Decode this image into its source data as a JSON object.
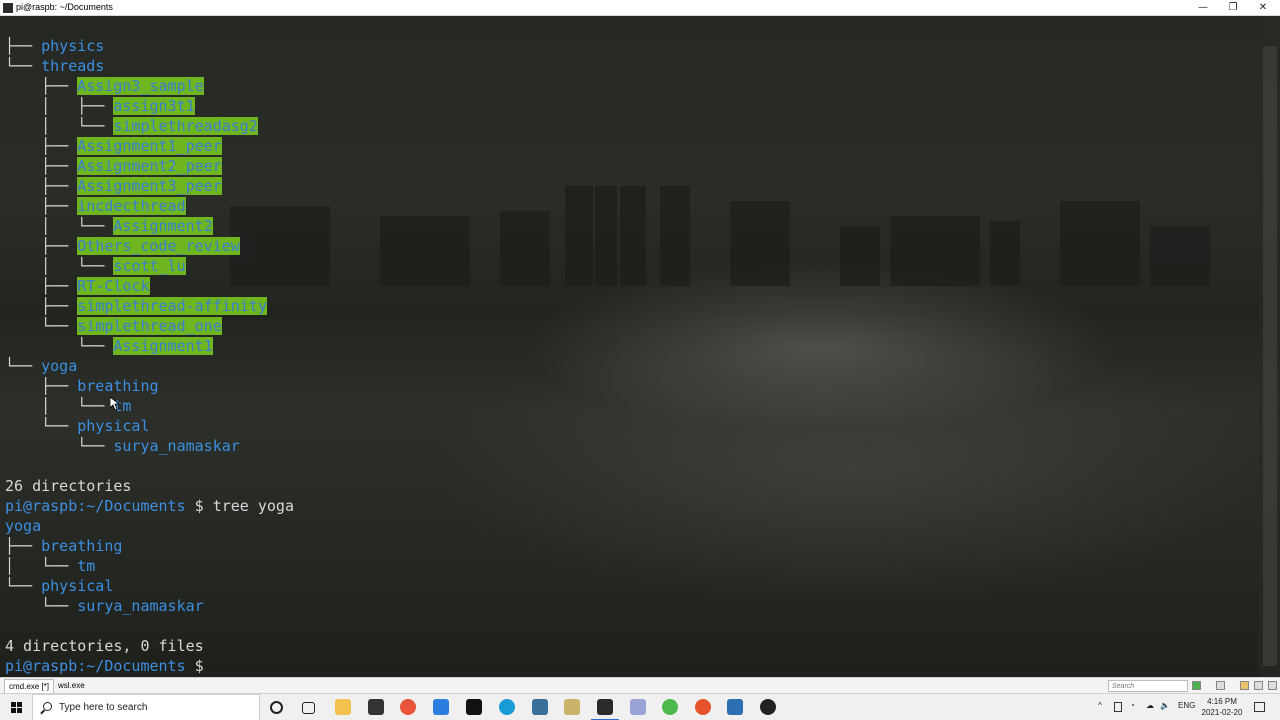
{
  "window": {
    "title": "pi@raspb: ~/Documents",
    "minimize_glyph": "—",
    "maximize_glyph": "❐",
    "close_glyph": "✕"
  },
  "terminal_lines": [
    {
      "tree": "├── ",
      "indent": "",
      "name": "physics",
      "style": "dir"
    },
    {
      "tree": "└── ",
      "indent": "",
      "name": "threads",
      "style": "dir"
    },
    {
      "tree": "    ├── ",
      "indent": "",
      "name": "Assign3_sample",
      "style": "hl"
    },
    {
      "tree": "    │   ├── ",
      "indent": "",
      "name": "assign3t1",
      "style": "hl"
    },
    {
      "tree": "    │   └── ",
      "indent": "",
      "name": "simplethreadasg2",
      "style": "hl"
    },
    {
      "tree": "    ├── ",
      "indent": "",
      "name": "Assignment1_peer",
      "style": "hl"
    },
    {
      "tree": "    ├── ",
      "indent": "",
      "name": "Assignment2_peer",
      "style": "hl"
    },
    {
      "tree": "    ├── ",
      "indent": "",
      "name": "Assignment3_peer",
      "style": "hl"
    },
    {
      "tree": "    ├── ",
      "indent": "",
      "name": "incdecthread",
      "style": "hl"
    },
    {
      "tree": "    │   └── ",
      "indent": "",
      "name": "Assignment2",
      "style": "hl"
    },
    {
      "tree": "    ├── ",
      "indent": "",
      "name": "Others_code_review",
      "style": "hl"
    },
    {
      "tree": "    │   └── ",
      "indent": "",
      "name": "scott_lu",
      "style": "hl"
    },
    {
      "tree": "    ├── ",
      "indent": "",
      "name": "RT-Clock",
      "style": "hl"
    },
    {
      "tree": "    ├── ",
      "indent": "",
      "name": "simplethread-affinity",
      "style": "hl"
    },
    {
      "tree": "    └── ",
      "indent": "",
      "name": "simplethread_one",
      "style": "hl"
    },
    {
      "tree": "        └── ",
      "indent": "",
      "name": "Assignment1",
      "style": "hl"
    },
    {
      "tree": "└── ",
      "indent": "",
      "name": "yoga",
      "style": "dir"
    },
    {
      "tree": "    ├── ",
      "indent": "",
      "name": "breathing",
      "style": "dir"
    },
    {
      "tree": "    │   └── ",
      "indent": "",
      "name": "tm",
      "style": "dir"
    },
    {
      "tree": "    └── ",
      "indent": "",
      "name": "physical",
      "style": "dir"
    },
    {
      "tree": "        └── ",
      "indent": "",
      "name": "surya_namaskar",
      "style": "dir"
    },
    {
      "tree": "",
      "indent": "",
      "name": "",
      "style": "txt"
    },
    {
      "tree": "",
      "indent": "",
      "name": "26 directories",
      "style": "txt"
    },
    {
      "tree": "",
      "indent": "",
      "name": "",
      "style": "prompt",
      "user": "pi@raspb",
      "path": ":~/Documents",
      "cmd": " $ tree yoga"
    },
    {
      "tree": "",
      "indent": "",
      "name": "yoga",
      "style": "dir"
    },
    {
      "tree": "├── ",
      "indent": "",
      "name": "breathing",
      "style": "dir"
    },
    {
      "tree": "│   └── ",
      "indent": "",
      "name": "tm",
      "style": "dir"
    },
    {
      "tree": "└── ",
      "indent": "",
      "name": "physical",
      "style": "dir"
    },
    {
      "tree": "    └── ",
      "indent": "",
      "name": "surya_namaskar",
      "style": "dir"
    },
    {
      "tree": "",
      "indent": "",
      "name": "",
      "style": "txt"
    },
    {
      "tree": "",
      "indent": "",
      "name": "4 directories, 0 files",
      "style": "txt"
    },
    {
      "tree": "",
      "indent": "",
      "name": "",
      "style": "prompt",
      "user": "pi@raspb",
      "path": ":~/Documents",
      "cmd": " $ "
    }
  ],
  "tabs": [
    {
      "label": "cmd.exe [*]",
      "active": true
    },
    {
      "label": "wsl.exe",
      "active": false
    }
  ],
  "tab_search_placeholder": "Search",
  "taskbar": {
    "search_placeholder": "Type here to search",
    "language": "ENG",
    "time": "4:16 PM",
    "date": "2021-02-20"
  },
  "colors": {
    "directory": "#3b8fe0",
    "highlight": "#6fb51f",
    "taskbar": "#f0f0f0"
  }
}
